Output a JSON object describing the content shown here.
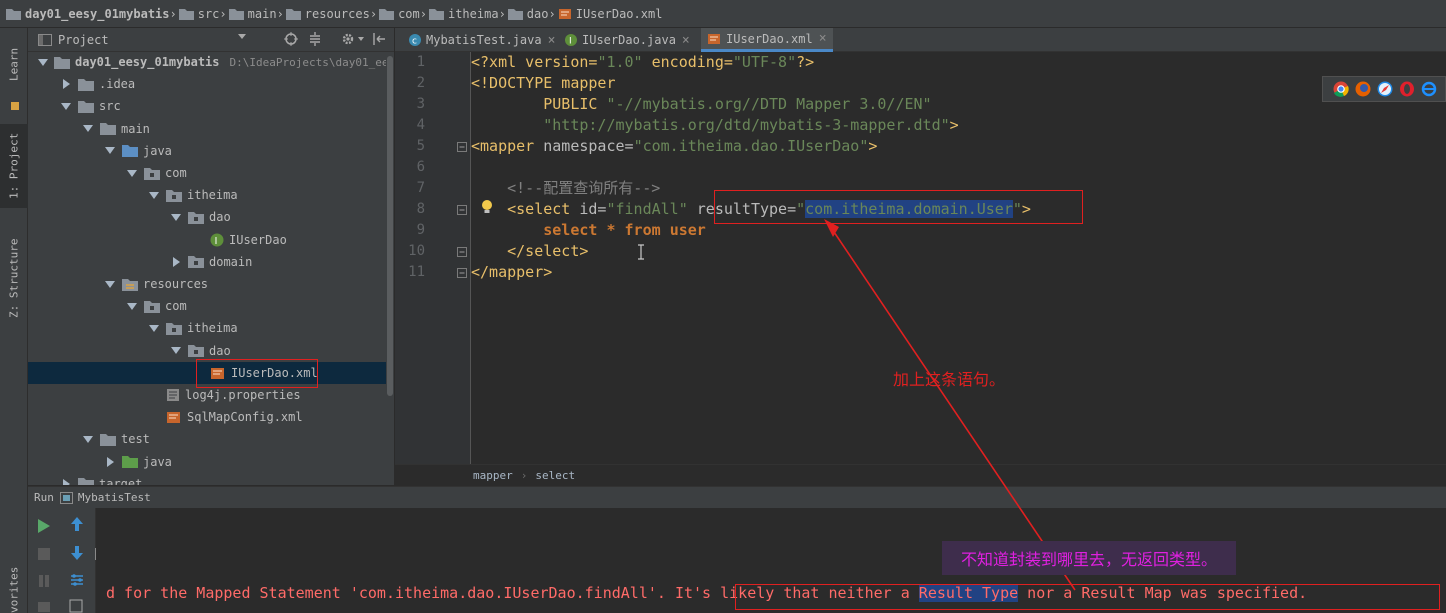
{
  "breadcrumb": [
    "day01_eesy_01mybatis",
    "src",
    "main",
    "resources",
    "com",
    "itheima",
    "dao",
    "IUserDao.xml"
  ],
  "left_strip": {
    "learn": "Learn",
    "project": "1: Project",
    "structure": "Z: Structure",
    "favorites": "vorites"
  },
  "project_panel": {
    "title": "Project",
    "tree": [
      {
        "label": "day01_eesy_01mybatis",
        "path": "D:\\IdeaProjects\\day01_ee",
        "depth": 0,
        "arrow": "down",
        "icon": "folder",
        "bold": true
      },
      {
        "label": ".idea",
        "depth": 1,
        "arrow": "right",
        "icon": "folder"
      },
      {
        "label": "src",
        "depth": 1,
        "arrow": "down",
        "icon": "folder"
      },
      {
        "label": "main",
        "depth": 2,
        "arrow": "down",
        "icon": "folder"
      },
      {
        "label": "java",
        "depth": 3,
        "arrow": "down",
        "icon": "folder-blue"
      },
      {
        "label": "com",
        "depth": 4,
        "arrow": "down",
        "icon": "package"
      },
      {
        "label": "itheima",
        "depth": 5,
        "arrow": "down",
        "icon": "package"
      },
      {
        "label": "dao",
        "depth": 6,
        "arrow": "down",
        "icon": "package"
      },
      {
        "label": "IUserDao",
        "depth": 7,
        "arrow": "none",
        "icon": "interface"
      },
      {
        "label": "domain",
        "depth": 6,
        "arrow": "right",
        "icon": "package"
      },
      {
        "label": "resources",
        "depth": 3,
        "arrow": "down",
        "icon": "folder-res"
      },
      {
        "label": "com",
        "depth": 4,
        "arrow": "down",
        "icon": "package"
      },
      {
        "label": "itheima",
        "depth": 5,
        "arrow": "down",
        "icon": "package"
      },
      {
        "label": "dao",
        "depth": 6,
        "arrow": "down",
        "icon": "package"
      },
      {
        "label": "IUserDao.xml",
        "depth": 7,
        "arrow": "none",
        "icon": "xml",
        "selected": true
      },
      {
        "label": "log4j.properties",
        "depth": 5,
        "arrow": "none",
        "icon": "props"
      },
      {
        "label": "SqlMapConfig.xml",
        "depth": 5,
        "arrow": "none",
        "icon": "xml"
      },
      {
        "label": "test",
        "depth": 2,
        "arrow": "down",
        "icon": "folder"
      },
      {
        "label": "java",
        "depth": 3,
        "arrow": "right",
        "icon": "folder-green"
      },
      {
        "label": "target",
        "depth": 1,
        "arrow": "right",
        "icon": "folder"
      }
    ]
  },
  "editor_tabs": [
    {
      "label": "MybatisTest.java",
      "icon": "class",
      "active": false
    },
    {
      "label": "IUserDao.java",
      "icon": "interface",
      "active": false
    },
    {
      "label": "IUserDao.xml",
      "icon": "xml",
      "active": true
    }
  ],
  "editor": {
    "line_numbers": [
      "1",
      "2",
      "3",
      "4",
      "5",
      "6",
      "7",
      "8",
      "9",
      "10",
      "11"
    ],
    "l1": {
      "a": "<?xml version=",
      "b": "\"1.0\"",
      "c": " encoding=",
      "d": "\"UTF-8\"",
      "e": "?>"
    },
    "l2": "<!DOCTYPE mapper",
    "l3": {
      "a": "        PUBLIC ",
      "b": "\"-//mybatis.org//DTD Mapper 3.0//EN\""
    },
    "l4": {
      "a": "        ",
      "b": "\"http://mybatis.org/dtd/mybatis-3-mapper.dtd\"",
      "c": ">"
    },
    "l5": {
      "a": "<mapper ",
      "b": "namespace=",
      "c": "\"com.itheima.dao.IUserDao\"",
      "d": ">"
    },
    "l7": "    <!--配置查询所有-->",
    "l8": {
      "a": "    <select ",
      "b": "id=",
      "c": "\"findAll\"",
      "d": " resultType=",
      "e": "\"",
      "f": "com.itheima.domain.User",
      "g": "\"",
      "h": ">"
    },
    "l9": {
      "a": "        ",
      "b": "select",
      "c": " * ",
      "d": "from",
      "e": " ",
      "f": "user"
    },
    "l10": "    </select>",
    "l11": "</mapper>",
    "crumb": {
      "a": "mapper",
      "b": "select"
    }
  },
  "run_panel": {
    "label": "Run",
    "config": "MybatisTest",
    "error_prefix": "d for the Mapped Statement 'com.itheima.dao.IUserDao.findAll'. ",
    "error_a": "It's likely that neither a ",
    "error_b": "Result Type",
    "error_c": " nor a Result Map was specified."
  },
  "annotations": {
    "add_statement": "加上这条语句。",
    "no_return": "不知道封装到哪里去，无返回类型。"
  },
  "colors": {
    "annotation_red": "#e02020",
    "annotation_magenta": "#e020e0",
    "selection": "#214283"
  }
}
